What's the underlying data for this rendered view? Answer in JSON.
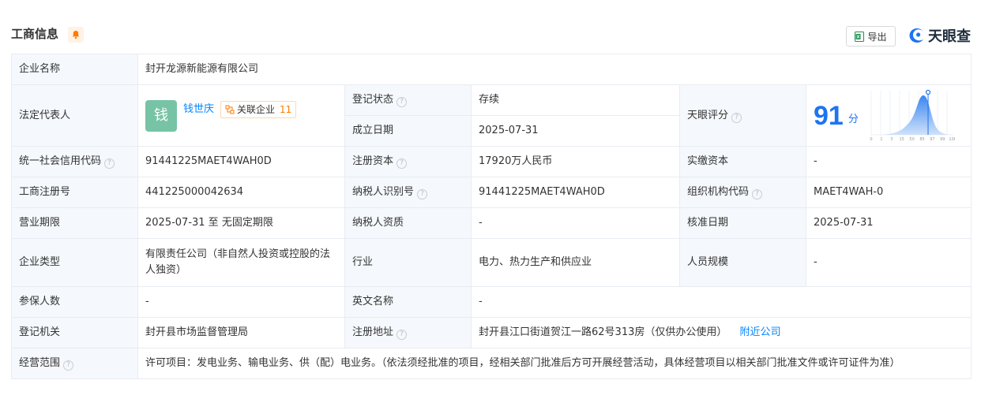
{
  "header": {
    "title": "工商信息",
    "export_label": "导出",
    "brand_name": "天眼查"
  },
  "rows": {
    "company_name": {
      "label": "企业名称",
      "value": "封开龙源新能源有限公司"
    },
    "legal_rep": {
      "label": "法定代表人",
      "avatar_char": "钱",
      "name": "钱世庆",
      "assoc_label": "关联企业",
      "assoc_count": "11"
    },
    "reg_status": {
      "label": "登记状态",
      "value": "存续"
    },
    "found_date": {
      "label": "成立日期",
      "value": "2025-07-31"
    },
    "tianyan_score": {
      "label": "天眼评分",
      "value": "91",
      "unit": "分",
      "axis_ticks": [
        "0",
        "1",
        "3",
        "15",
        "50",
        "85",
        "97",
        "99",
        "100"
      ]
    },
    "credit_code": {
      "label": "统一社会信用代码",
      "value": "91441225MAET4WAH0D"
    },
    "reg_capital": {
      "label": "注册资本",
      "value": "17920万人民币"
    },
    "paid_capital": {
      "label": "实缴资本",
      "value": "-"
    },
    "biz_reg_no": {
      "label": "工商注册号",
      "value": "441225000042634"
    },
    "taxpayer_id": {
      "label": "纳税人识别号",
      "value": "91441225MAET4WAH0D"
    },
    "org_code": {
      "label": "组织机构代码",
      "value": "MAET4WAH-0"
    },
    "biz_term": {
      "label": "营业期限",
      "value": "2025-07-31 至 无固定期限"
    },
    "taxpayer_qual": {
      "label": "纳税人资质",
      "value": "-"
    },
    "approve_date": {
      "label": "核准日期",
      "value": "2025-07-31"
    },
    "company_type": {
      "label": "企业类型",
      "value": "有限责任公司（非自然人投资或控股的法人独资）"
    },
    "industry": {
      "label": "行业",
      "value": "电力、热力生产和供应业"
    },
    "staff_size": {
      "label": "人员规模",
      "value": "-"
    },
    "insured": {
      "label": "参保人数",
      "value": "-"
    },
    "english_name": {
      "label": "英文名称",
      "value": "-"
    },
    "reg_authority": {
      "label": "登记机关",
      "value": "封开县市场监督管理局"
    },
    "reg_address": {
      "label": "注册地址",
      "value": "封开县江口街道贺江一路62号313房（仅供办公使用）",
      "link": "附近公司"
    },
    "biz_scope": {
      "label": "经营范围",
      "value": "许可项目：发电业务、输电业务、供（配）电业务。（依法须经批准的项目，经相关部门批准后方可开展经营活动，具体经营项目以相关部门批准文件或许可证件为准）"
    }
  },
  "colors": {
    "accent": "#0084ff",
    "status_green": "#00a870",
    "score_blue": "#1e74f0",
    "label_bg": "#f5f8fc",
    "border": "#e8ecf2"
  },
  "icons": [
    "bell-icon",
    "excel-icon",
    "brand-logo-icon",
    "help-icon",
    "related-company-icon"
  ]
}
